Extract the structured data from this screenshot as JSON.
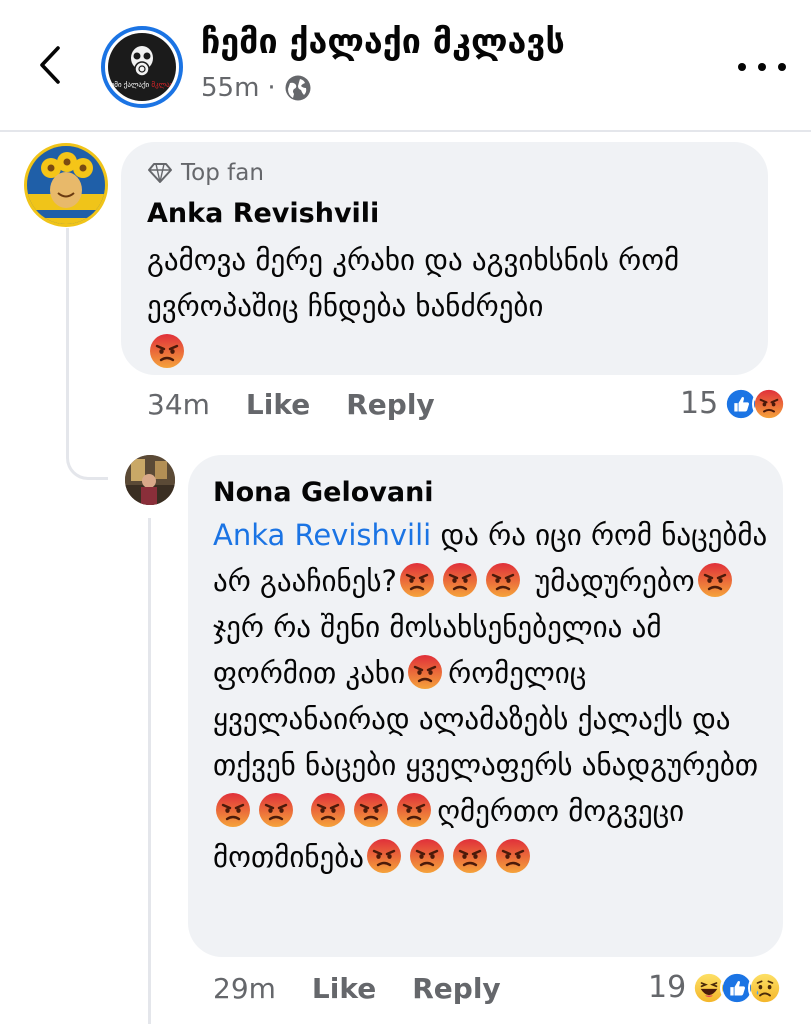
{
  "header": {
    "page_name": "ჩემი ქალაქი მკლავს",
    "time": "55m",
    "separator": "·",
    "privacy_icon": "globe-icon",
    "avatar_text_white": "ჩემი ქალაქი",
    "avatar_text_red": "მკლავს"
  },
  "comments": [
    {
      "badge": "Top fan",
      "badge_icon": "diamond-icon",
      "author": "Anka Revishvili",
      "text": "გამოვა მერე კრახი და აგვიხსნის რომ ევროპაშიც ჩნდება ხანძრები",
      "time": "34m",
      "like_label": "Like",
      "reply_label": "Reply",
      "reaction_count": "15",
      "reactions": [
        "like",
        "angry"
      ]
    },
    {
      "author": "Nona Gelovani",
      "mention": "Anka Revishvili",
      "text_parts": [
        "და რა იცი რომ ნაცებმა არ გააჩინეს?",
        "უმადურებო",
        "ჯერ რა შენი მოსახსენებელია ამ ფორმით კახი",
        "რომელიც ყველანაირად ალამაზებს ქალაქს და თქვენ ნაცები ყველაფერს ანადგურებთ",
        "ღმერთო მოგვეცი მოთმინება"
      ],
      "time": "29m",
      "like_label": "Like",
      "reply_label": "Reply",
      "reaction_count": "19",
      "reactions": [
        "haha",
        "like",
        "sad"
      ]
    }
  ],
  "colors": {
    "accent": "#1b74e4",
    "bubble": "#f0f2f5",
    "secondary_text": "#65676b",
    "angry": "#f0582a"
  }
}
